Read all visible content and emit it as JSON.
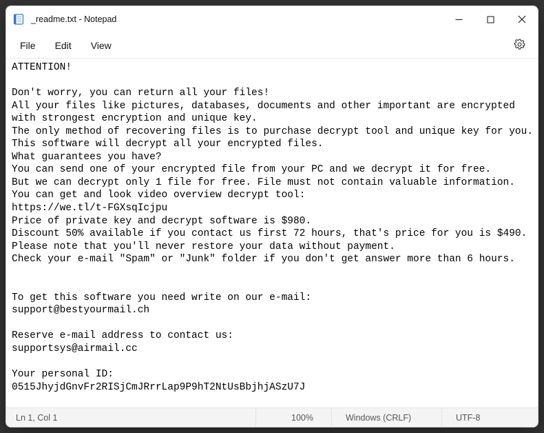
{
  "window": {
    "title": "_readme.txt - Notepad"
  },
  "menu": {
    "file": "File",
    "edit": "Edit",
    "view": "View"
  },
  "document": {
    "text": "ATTENTION!\n\nDon't worry, you can return all your files!\nAll your files like pictures, databases, documents and other important are encrypted with strongest encryption and unique key.\nThe only method of recovering files is to purchase decrypt tool and unique key for you.\nThis software will decrypt all your encrypted files.\nWhat guarantees you have?\nYou can send one of your encrypted file from your PC and we decrypt it for free.\nBut we can decrypt only 1 file for free. File must not contain valuable information.\nYou can get and look video overview decrypt tool:\nhttps://we.tl/t-FGXsqIcjpu\nPrice of private key and decrypt software is $980.\nDiscount 50% available if you contact us first 72 hours, that's price for you is $490.\nPlease note that you'll never restore your data without payment.\nCheck your e-mail \"Spam\" or \"Junk\" folder if you don't get answer more than 6 hours.\n\n\nTo get this software you need write on our e-mail:\nsupport@bestyourmail.ch\n\nReserve e-mail address to contact us:\nsupportsys@airmail.cc\n\nYour personal ID:\n0515JhyjdGnvFr2RISjCmJRrrLap9P9hT2NtUsBbjhjASzU7J"
  },
  "statusbar": {
    "position": "Ln 1, Col 1",
    "zoom": "100%",
    "eol": "Windows (CRLF)",
    "encoding": "UTF-8"
  }
}
